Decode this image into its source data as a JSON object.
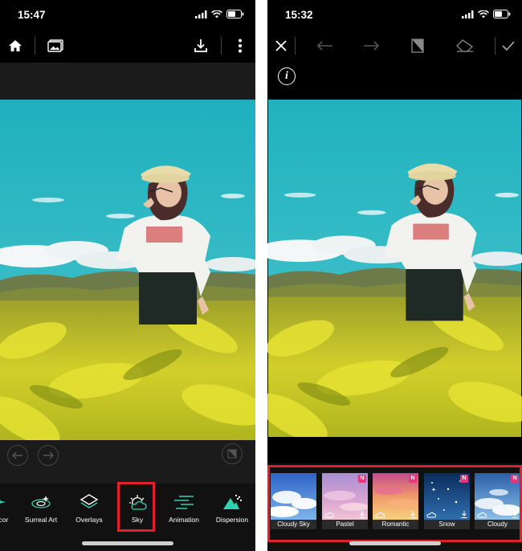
{
  "left_screen": {
    "status_time": "15:47",
    "toolbar": {
      "home_icon": "home-icon",
      "gallery_icon": "gallery-icon",
      "download_icon": "download-icon",
      "more_icon": "more-vertical-icon"
    },
    "tools": [
      {
        "label": "Decor",
        "icon": "decor-icon"
      },
      {
        "label": "Surreal Art",
        "icon": "surreal-art-icon"
      },
      {
        "label": "Overlays",
        "icon": "layers-icon"
      },
      {
        "label": "Sky",
        "icon": "sky-icon",
        "selected": true
      },
      {
        "label": "Animation",
        "icon": "animation-icon"
      },
      {
        "label": "Dispersion",
        "icon": "dispersion-icon"
      }
    ]
  },
  "right_screen": {
    "status_time": "15:32",
    "toolbar": {
      "close_icon": "close-icon",
      "undo_icon": "undo-icon",
      "redo_icon": "redo-icon",
      "compare_icon": "compare-icon",
      "eraser_icon": "eraser-icon",
      "apply_icon": "check-icon",
      "info_icon": "info-icon"
    },
    "sky_presets": [
      {
        "label": "Cloudy Sky",
        "is_new": false
      },
      {
        "label": "Pastel",
        "is_new": true,
        "badge": "N"
      },
      {
        "label": "Romantic",
        "is_new": true,
        "badge": "N"
      },
      {
        "label": "Snow",
        "is_new": true,
        "badge": "N"
      },
      {
        "label": "Cloudy",
        "is_new": true,
        "badge": "N"
      }
    ]
  },
  "colors": {
    "highlight": "#e0202a",
    "new_badge": "#e8367a",
    "sky": "#2fb8c4",
    "foliage": "#c9c72a"
  }
}
